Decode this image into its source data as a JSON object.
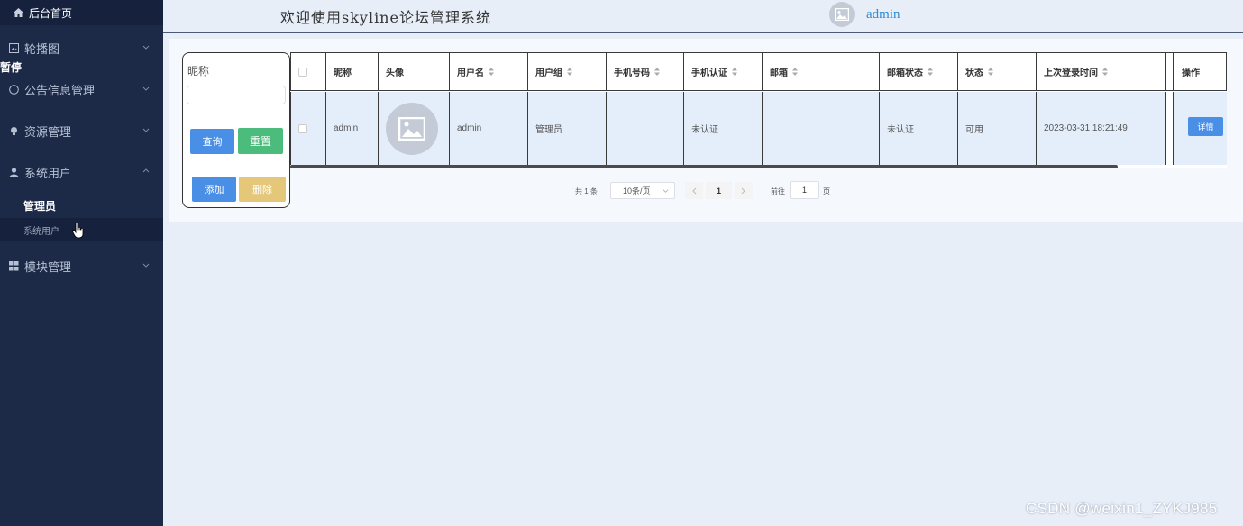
{
  "sidebar": {
    "home_label": "后台首页",
    "items": [
      {
        "label": "轮播图",
        "icon": "picture-icon"
      },
      {
        "label": "公告信息管理",
        "icon": "info-icon"
      },
      {
        "label": "资源管理",
        "icon": "bulb-icon"
      },
      {
        "label": "系统用户",
        "icon": "user-icon"
      },
      {
        "label": "模块管理",
        "icon": "grid-icon"
      }
    ],
    "sub_items": [
      {
        "label": "管理员"
      },
      {
        "label": "系统用户"
      }
    ],
    "paused_text": "暂停"
  },
  "header": {
    "title": "欢迎使用skyline论坛管理系统",
    "username": "admin"
  },
  "search": {
    "label": "昵称",
    "input_value": "",
    "query_label": "查询",
    "reset_label": "重置",
    "add_label": "添加",
    "delete_label": "删除"
  },
  "table": {
    "columns": [
      "昵称",
      "头像",
      "用户名",
      "用户组",
      "手机号码",
      "手机认证",
      "邮箱",
      "邮箱状态",
      "状态",
      "上次登录时间",
      "操作"
    ],
    "rows": [
      {
        "nickname": "admin",
        "username": "admin",
        "group": "管理员",
        "phone": "",
        "phone_auth": "未认证",
        "email": "",
        "email_status": "未认证",
        "status": "可用",
        "last_login": "2023-03-31 18:21:49",
        "action_label": "详情"
      }
    ]
  },
  "pagination": {
    "total_text": "共 1 条",
    "page_size": "10条/页",
    "current_page": "1",
    "goto_label": "前往",
    "goto_value": "1",
    "page_unit": "页"
  },
  "watermark": "CSDN @weixin1_ZYKJ985",
  "colors": {
    "sidebar_bg": "#1c2a48",
    "primary": "#4a8fe6",
    "success": "#4cbc7c",
    "warning": "#e4c778"
  }
}
